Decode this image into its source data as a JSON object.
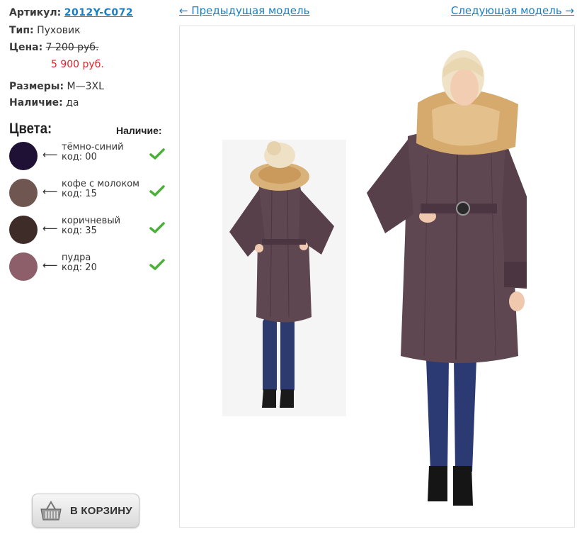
{
  "product": {
    "article_label": "Артикул:",
    "article_value": "2012Y-C072",
    "type_label": "Тип:",
    "type_value": "Пуховик",
    "price_label": "Цена:",
    "old_price": "7 200 руб.",
    "new_price": "5 900 руб.",
    "sizes_label": "Размеры:",
    "sizes_value": "M—3XL",
    "availability_label": "Наличие:",
    "availability_value": "да"
  },
  "colors": {
    "title": "Цвета:",
    "availability_header": "Наличие:",
    "items": [
      {
        "name": "тёмно-синий",
        "code": "код: 00",
        "swatch": "#1f1035",
        "available": true
      },
      {
        "name": "кофе с молоком",
        "code": "код: 15",
        "swatch": "#6f5650",
        "available": true
      },
      {
        "name": "коричневый",
        "code": "код: 35",
        "swatch": "#3e2c28",
        "available": true
      },
      {
        "name": "пудра",
        "code": "код: 20",
        "swatch": "#8c5f6a",
        "available": true
      }
    ]
  },
  "cart": {
    "label": "В КОРЗИНУ"
  },
  "nav": {
    "prev_label": "← Предыдущая модель",
    "next_label": "Следующая модель →"
  },
  "theme": {
    "link_color": "#1a7fc1",
    "sale_price_color": "#e8202a",
    "coat_color": "#5e4750",
    "check_color": "#4caf3a"
  }
}
